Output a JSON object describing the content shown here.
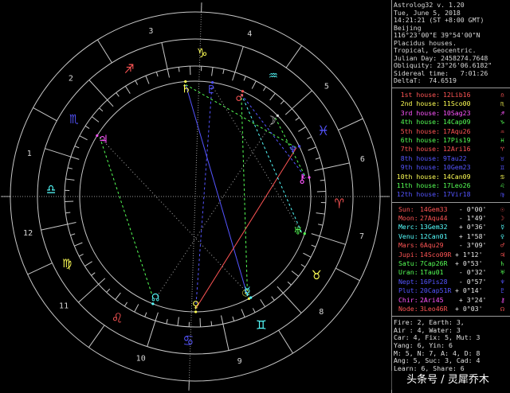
{
  "info": {
    "lines": [
      "Astrolog32 v. 1.20",
      "Tue, June 5, 2018",
      "14:21:21 (ST +8:00 GMT)",
      "Beijing",
      "116°23'00\"E 39°54'00\"N",
      "Placidus houses.",
      "Tropical, Geocentric.",
      "Julian Day: 2458274.7648",
      "Obliquity: 23°26'06.6182\"",
      "Sidereal time:   7:01:26",
      "DeltaT:  74.6519"
    ]
  },
  "houses": [
    {
      "name": "1st house:",
      "value": "12Lib16",
      "glyph": "♎",
      "color": "#ff5555"
    },
    {
      "name": "2nd house:",
      "value": "11Sco00",
      "glyph": "♏",
      "color": "#ffff55"
    },
    {
      "name": "3rd house:",
      "value": "10Sag23",
      "glyph": "♐",
      "color": "#ff55ff"
    },
    {
      "name": "4th house:",
      "value": "14Cap09",
      "glyph": "♑",
      "color": "#55ff55"
    },
    {
      "name": "5th house:",
      "value": "17Aqu26",
      "glyph": "♒",
      "color": "#ff5555"
    },
    {
      "name": "6th house:",
      "value": "17Pis19",
      "glyph": "♓",
      "color": "#55ff55"
    },
    {
      "name": "7th house:",
      "value": "12Ari16",
      "glyph": "♈",
      "color": "#ff5555"
    },
    {
      "name": "8th house:",
      "value": "9Tau22",
      "glyph": "♉",
      "color": "#5555ff"
    },
    {
      "name": "9th house:",
      "value": "10Gem23",
      "glyph": "♊",
      "color": "#5555ff"
    },
    {
      "name": "10th house:",
      "value": "14Can09",
      "glyph": "♋",
      "color": "#ffff55"
    },
    {
      "name": "11th house:",
      "value": "17Leo26",
      "glyph": "♌",
      "color": "#55ff55"
    },
    {
      "name": "12th house:",
      "value": "17Vir18",
      "glyph": "♍",
      "color": "#5555ff"
    }
  ],
  "planets": [
    {
      "name": "Sun:",
      "pos": "14Gem33",
      "aspect": " - 0°00'",
      "glyph": "☉",
      "color": "#ff5555"
    },
    {
      "name": "Moon:",
      "pos": "27Aqu44",
      "aspect": " - 1°49'",
      "glyph": "☽",
      "color": "#ff5555"
    },
    {
      "name": "Merc:",
      "pos": "13Gem32",
      "aspect": " + 0°36'",
      "glyph": "☿",
      "color": "#55ffff"
    },
    {
      "name": "Venu:",
      "pos": "12Can01",
      "aspect": " + 1°58'",
      "glyph": "♀",
      "color": "#55ffff"
    },
    {
      "name": "Mars:",
      "pos": "6Aqu29",
      "aspect": " - 3°09'",
      "glyph": "♂",
      "color": "#ff5555"
    },
    {
      "name": "Jupi:",
      "pos": "14Sco09R",
      "aspect": "+ 1°12'",
      "glyph": "♃",
      "color": "#ff5555"
    },
    {
      "name": "Satu:",
      "pos": "7Cap26R",
      "aspect": "+ 0°53'",
      "glyph": "♄",
      "color": "#55ff55"
    },
    {
      "name": "Uran:",
      "pos": "1Tau01",
      "aspect": " - 0°32'",
      "glyph": "♅",
      "color": "#55ff55"
    },
    {
      "name": "Nept:",
      "pos": "16Pis28",
      "aspect": " - 0°57'",
      "glyph": "♆",
      "color": "#5555ff"
    },
    {
      "name": "Plut:",
      "pos": "20Cap51R",
      "aspect": "+ 0°14'",
      "glyph": "♇",
      "color": "#5555ff"
    },
    {
      "name": "Chir:",
      "pos": "2Ari45",
      "aspect": " + 3°24'",
      "glyph": "⚷",
      "color": "#ff55ff"
    },
    {
      "name": "Node:",
      "pos": "3Leo46R",
      "aspect": "+ 0°03'",
      "glyph": "☊",
      "color": "#ff5555"
    }
  ],
  "stats": {
    "lines": [
      "Fire: 2, Earth: 3,",
      "Air : 4, Water: 3",
      "Car: 4, Fix: 5, Mut: 3",
      "Yang: 6, Yin: 6",
      "M: 5, N: 7, A: 4, D: 8",
      "Ang: 5, Suc: 3, Cad: 4",
      "Learn: 6, Share: 6"
    ]
  },
  "wheel": {
    "ascendant_longitude": 192.27,
    "house_numbers": [
      "1",
      "2",
      "3",
      "4",
      "5",
      "6",
      "7",
      "8",
      "9",
      "10",
      "11",
      "12"
    ],
    "house_cusps_longitude": [
      192.27,
      221.0,
      250.38,
      284.15,
      317.43,
      347.32,
      12.27,
      39.37,
      70.38,
      104.15,
      137.43,
      167.3
    ],
    "signs": [
      {
        "glyph": "♈",
        "color": "#ff5555"
      },
      {
        "glyph": "♉",
        "color": "#ffff55"
      },
      {
        "glyph": "♊",
        "color": "#55ffff"
      },
      {
        "glyph": "♋",
        "color": "#5555ff"
      },
      {
        "glyph": "♌",
        "color": "#ff5555"
      },
      {
        "glyph": "♍",
        "color": "#ffff55"
      },
      {
        "glyph": "♎",
        "color": "#55ffff"
      },
      {
        "glyph": "♏",
        "color": "#5555ff"
      },
      {
        "glyph": "♐",
        "color": "#ff5555"
      },
      {
        "glyph": "♑",
        "color": "#ffff55"
      },
      {
        "glyph": "♒",
        "color": "#55ffff"
      },
      {
        "glyph": "♓",
        "color": "#5555ff"
      }
    ],
    "planets": [
      {
        "glyph": "☉",
        "longitude": 74.55,
        "color": "#ffff55"
      },
      {
        "glyph": "☽",
        "longitude": 327.73,
        "color": "#dddddd"
      },
      {
        "glyph": "☿",
        "longitude": 73.53,
        "color": "#55ffff"
      },
      {
        "glyph": "♀",
        "longitude": 102.02,
        "color": "#ffff55"
      },
      {
        "glyph": "♂",
        "longitude": 306.48,
        "color": "#ff5555"
      },
      {
        "glyph": "♃",
        "longitude": 224.15,
        "color": "#ff55ff"
      },
      {
        "glyph": "♄",
        "longitude": 277.43,
        "color": "#ffff55"
      },
      {
        "glyph": "♅",
        "longitude": 31.02,
        "color": "#55ff55"
      },
      {
        "glyph": "♆",
        "longitude": 346.47,
        "color": "#5555ff"
      },
      {
        "glyph": "♇",
        "longitude": 290.85,
        "color": "#5555ff"
      },
      {
        "glyph": "⚷",
        "longitude": 2.75,
        "color": "#ff55ff"
      },
      {
        "glyph": "☊",
        "longitude": 123.77,
        "color": "#55ffff"
      }
    ]
  },
  "watermark": "头条号 / 灵犀乔木"
}
